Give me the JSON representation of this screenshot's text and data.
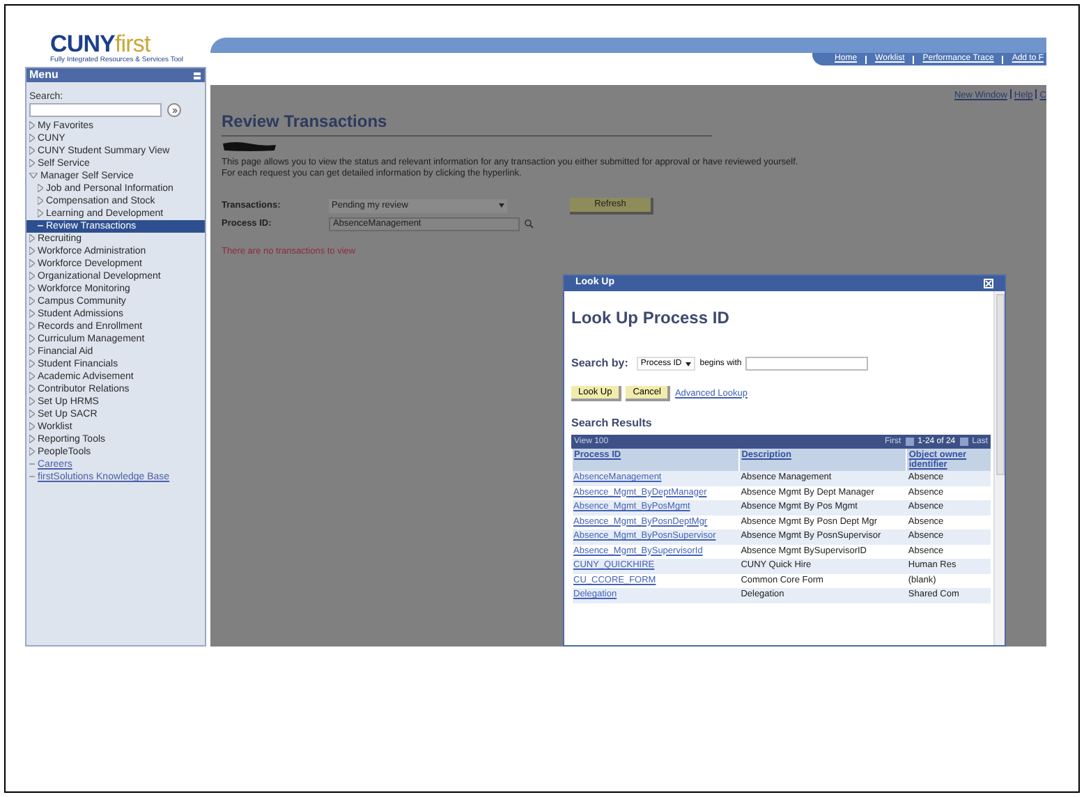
{
  "logo": {
    "prefix": "CUNY",
    "suffix": "first",
    "tagline": "Fully Integrated Resources & Services Tool"
  },
  "menu": {
    "title": "Menu",
    "search_label": "Search:",
    "items": [
      {
        "label": "My Favorites",
        "kind": "folder",
        "selected": false
      },
      {
        "label": "CUNY",
        "kind": "folder",
        "selected": false
      },
      {
        "label": "CUNY Student Summary View",
        "kind": "folder",
        "selected": false
      },
      {
        "label": "Self Service",
        "kind": "folder",
        "selected": false
      },
      {
        "label": "Manager Self Service",
        "kind": "folder",
        "expanded": true,
        "selected": false,
        "children": [
          {
            "label": "Job and Personal Information",
            "kind": "folder",
            "selected": false
          },
          {
            "label": "Compensation and Stock",
            "kind": "folder",
            "selected": false
          },
          {
            "label": "Learning and Development",
            "kind": "folder",
            "selected": false
          },
          {
            "label": "Review Transactions",
            "kind": "page",
            "selected": true
          }
        ]
      },
      {
        "label": "Recruiting",
        "kind": "folder",
        "selected": false
      },
      {
        "label": "Workforce Administration",
        "kind": "folder",
        "selected": false
      },
      {
        "label": "Workforce Development",
        "kind": "folder",
        "selected": false
      },
      {
        "label": "Organizational Development",
        "kind": "folder",
        "selected": false
      },
      {
        "label": "Workforce Monitoring",
        "kind": "folder",
        "selected": false
      },
      {
        "label": "Campus Community",
        "kind": "folder",
        "selected": false
      },
      {
        "label": "Student Admissions",
        "kind": "folder",
        "selected": false
      },
      {
        "label": "Records and Enrollment",
        "kind": "folder",
        "selected": false
      },
      {
        "label": "Curriculum Management",
        "kind": "folder",
        "selected": false
      },
      {
        "label": "Financial Aid",
        "kind": "folder",
        "selected": false
      },
      {
        "label": "Student Financials",
        "kind": "folder",
        "selected": false
      },
      {
        "label": "Academic Advisement",
        "kind": "folder",
        "selected": false
      },
      {
        "label": "Contributor Relations",
        "kind": "folder",
        "selected": false
      },
      {
        "label": "Set Up HRMS",
        "kind": "folder",
        "selected": false
      },
      {
        "label": "Set Up SACR",
        "kind": "folder",
        "selected": false
      },
      {
        "label": "Worklist",
        "kind": "folder",
        "selected": false
      },
      {
        "label": "Reporting Tools",
        "kind": "folder",
        "selected": false
      },
      {
        "label": "PeopleTools",
        "kind": "folder",
        "selected": false
      },
      {
        "label": "Careers",
        "kind": "link",
        "selected": false
      },
      {
        "label": "firstSolutions Knowledge Base",
        "kind": "link",
        "selected": false
      }
    ]
  },
  "header_nav": [
    "Home",
    "Worklist",
    "Performance Trace",
    "Add to F"
  ],
  "page_links": [
    "New Window",
    "Help",
    "C"
  ],
  "page": {
    "title": "Review Transactions",
    "description": "This page allows you to view the status and relevant information for any transaction you either submitted for approval or have reviewed yourself. For each request you can get detailed information by clicking the hyperlink.",
    "transactions_label": "Transactions:",
    "transactions_value": "Pending my review",
    "process_label": "Process ID:",
    "process_value": "AbsenceManagement",
    "refresh": "Refresh",
    "message": "There are no transactions to view"
  },
  "lookup": {
    "window_title": "Look Up",
    "title": "Look Up Process ID",
    "search_by_label": "Search by:",
    "search_by_value": "Process ID",
    "operator": "begins with",
    "buttons": [
      "Look Up",
      "Cancel"
    ],
    "advanced_link": "Advanced Lookup",
    "results_title": "Search Results",
    "view_all": "View 100",
    "first": "First",
    "range": "1-24 of 24",
    "last": "Last",
    "columns": [
      "Process ID",
      "Description",
      "Object owner identifier"
    ],
    "rows": [
      [
        "AbsenceManagement",
        "Absence Management",
        "Absence"
      ],
      [
        "Absence_Mgmt_ByDeptManager",
        "Absence Mgmt By Dept Manager",
        "Absence"
      ],
      [
        "Absence_Mgmt_ByPosMgmt",
        "Absence Mgmt By Pos Mgmt",
        "Absence"
      ],
      [
        "Absence_Mgmt_ByPosnDeptMgr",
        "Absence Mgmt By Posn Dept Mgr",
        "Absence"
      ],
      [
        "Absence_Mgmt_ByPosnSupervisor",
        "Absence Mgmt By PosnSupervisor",
        "Absence"
      ],
      [
        "Absence_Mgmt_BySupervisorId",
        "Absence Mgmt BySupervisorID",
        "Absence"
      ],
      [
        "CUNY_QUICKHIRE",
        "CUNY Quick Hire",
        "Human Res"
      ],
      [
        "CU_CCORE_FORM",
        "Common Core Form",
        "(blank)"
      ],
      [
        "Delegation",
        "Delegation",
        "Shared Com"
      ]
    ]
  }
}
